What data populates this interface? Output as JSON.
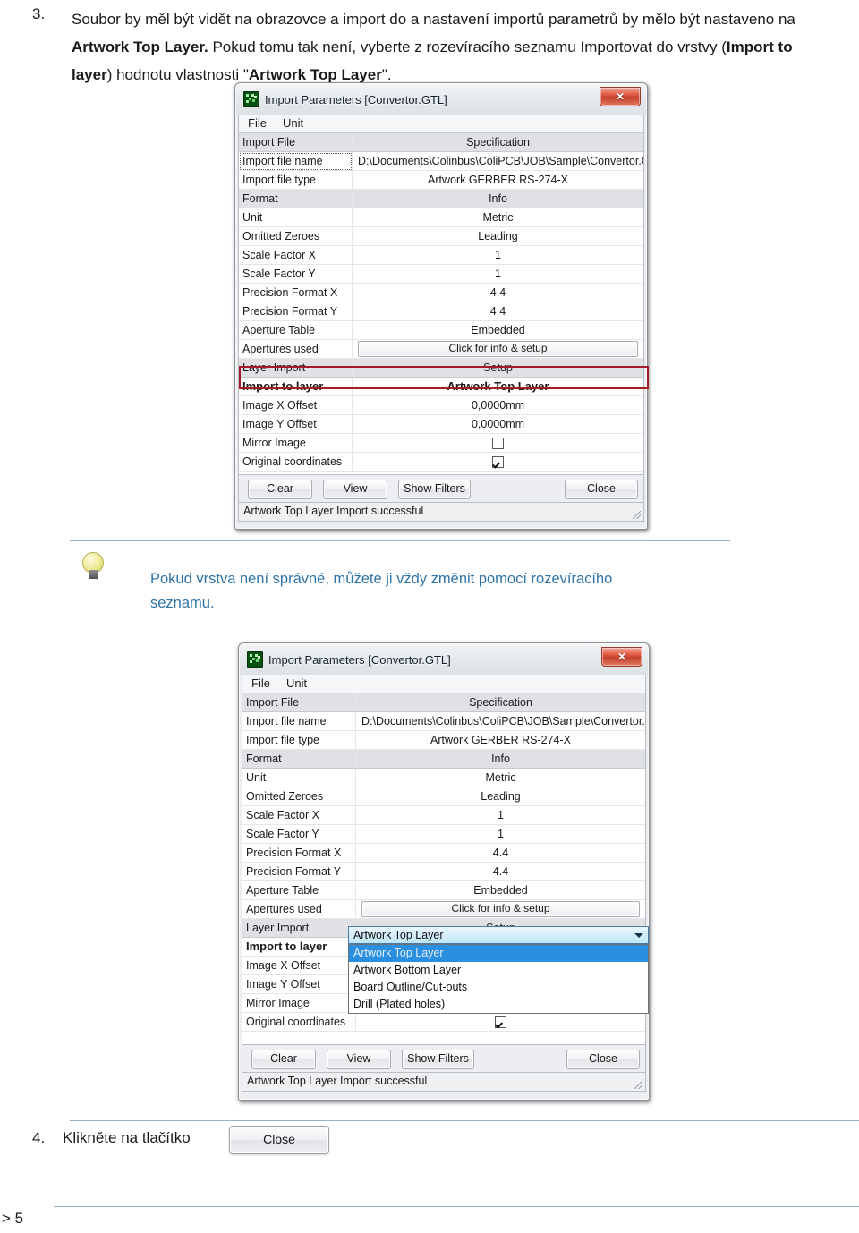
{
  "document": {
    "step3": {
      "number": "3.",
      "line1_a": "Soubor by měl být vidět na obrazovce a import do a nastavení importů parametrů by mělo být nastaveno na ",
      "line1_b": "Artwork Top Layer.",
      "line1_c": " Pokud tomu tak není, vyberte z rozevíracího seznamu Importovat do vrstvy (",
      "line1_d": "Import to layer",
      "line1_e": ") hodnotu vlastnosti \"",
      "line1_f": "Artwork Top Layer",
      "line1_g": "\"."
    },
    "tip": {
      "icon": "lightbulb-icon",
      "text": "Pokud vrstva není správné, můžete ji vždy změnit pomocí rozevíracího seznamu.",
      "color": "#2e74a8"
    },
    "step4": {
      "number": "4.",
      "text": "Klikněte na tlačítko",
      "button_label": "Close"
    },
    "page_number": "> 5"
  },
  "dialog": {
    "title": "Import Parameters [Convertor.GTL]",
    "app_icon": "pcb-icon",
    "close_icon": "close-icon",
    "close_glyph": "✕",
    "menu": [
      "File",
      "Unit"
    ],
    "sections": {
      "import_file_header": {
        "key": "Import File",
        "value": "Specification"
      },
      "format_header": {
        "key": "Format",
        "value": "Info"
      },
      "layer_import_header": {
        "key": "Layer Import",
        "value": "Setup"
      }
    },
    "rows": [
      {
        "key": "Import file name",
        "value": "D:\\Documents\\Colinbus\\ColiPCB\\JOB\\Sample\\Convertor.GTL"
      },
      {
        "key": "Import file type",
        "value": "Artwork GERBER RS-274-X"
      },
      {
        "key": "Unit",
        "value": "Metric"
      },
      {
        "key": "Omitted Zeroes",
        "value": "Leading"
      },
      {
        "key": "Scale Factor X",
        "value": "1"
      },
      {
        "key": "Scale Factor Y",
        "value": "1"
      },
      {
        "key": "Precision Format X",
        "value": "4.4"
      },
      {
        "key": "Precision Format Y",
        "value": "4.4"
      },
      {
        "key": "Aperture Table",
        "value": "Embedded"
      },
      {
        "key": "Apertures used",
        "value": "Click for info & setup"
      },
      {
        "key": "Import to layer",
        "value": "Artwork Top Layer"
      },
      {
        "key": "Image X Offset",
        "value": "0,0000mm"
      },
      {
        "key": "Image Y Offset",
        "value": "0,0000mm"
      },
      {
        "key": "Mirror Image",
        "value": ""
      },
      {
        "key": "Original coordinates",
        "value": ""
      }
    ],
    "checkboxes": {
      "mirror_image": false,
      "original_coordinates": true
    },
    "buttons": {
      "clear": "Clear",
      "view": "View",
      "show_filters": "Show Filters",
      "close": "Close"
    },
    "status": "Artwork Top Layer Import successful",
    "highlight_color": "#a51b25"
  },
  "dropdown": {
    "selected": "Artwork Top Layer",
    "arrow_icon": "chevron-down-icon",
    "options": [
      "Artwork Top Layer",
      "Artwork Bottom Layer",
      "Board Outline/Cut-outs",
      "Drill (Plated holes)"
    ],
    "selected_index": 0,
    "highlight_color": "#2a8fe0"
  }
}
